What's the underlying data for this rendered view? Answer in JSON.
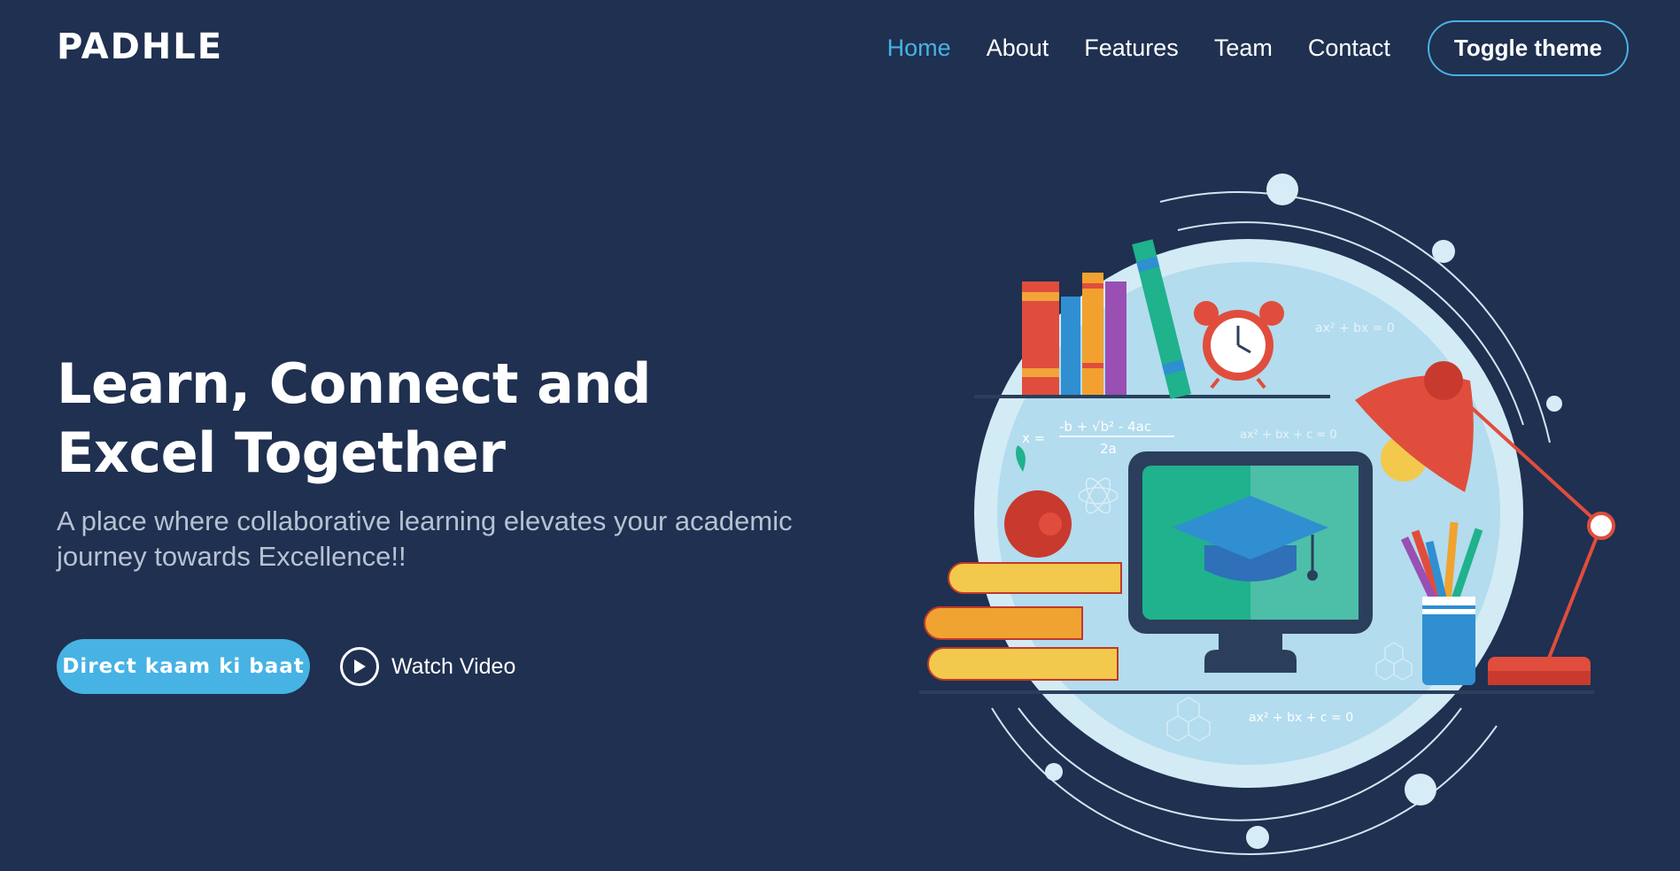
{
  "nav": {
    "logo": "PADHLE",
    "items": [
      {
        "label": "Home",
        "active": true
      },
      {
        "label": "About",
        "active": false
      },
      {
        "label": "Features",
        "active": false
      },
      {
        "label": "Team",
        "active": false
      },
      {
        "label": "Contact",
        "active": false
      }
    ],
    "toggle_label": "Toggle theme"
  },
  "hero": {
    "headline_line1": "Learn, Connect and",
    "headline_line2": "Excel Together",
    "subtext": "A place where collaborative learning elevates your academic journey towards Excellence!!",
    "cta_label": "Direct kaam ki baat",
    "watch_label": "Watch Video"
  },
  "illustration": {
    "equation_1": "ax² + bx = 0",
    "equation_2": "ax² + bx + c = 0",
    "equation_3": "ax² + bx + c = 0",
    "formula_lhs": "x =",
    "formula_num": "-b + √b² - 4ac",
    "formula_den": "2a"
  },
  "colors": {
    "background": "#1f3050",
    "accent": "#47b2e4",
    "subtext": "#b6c2d3"
  }
}
